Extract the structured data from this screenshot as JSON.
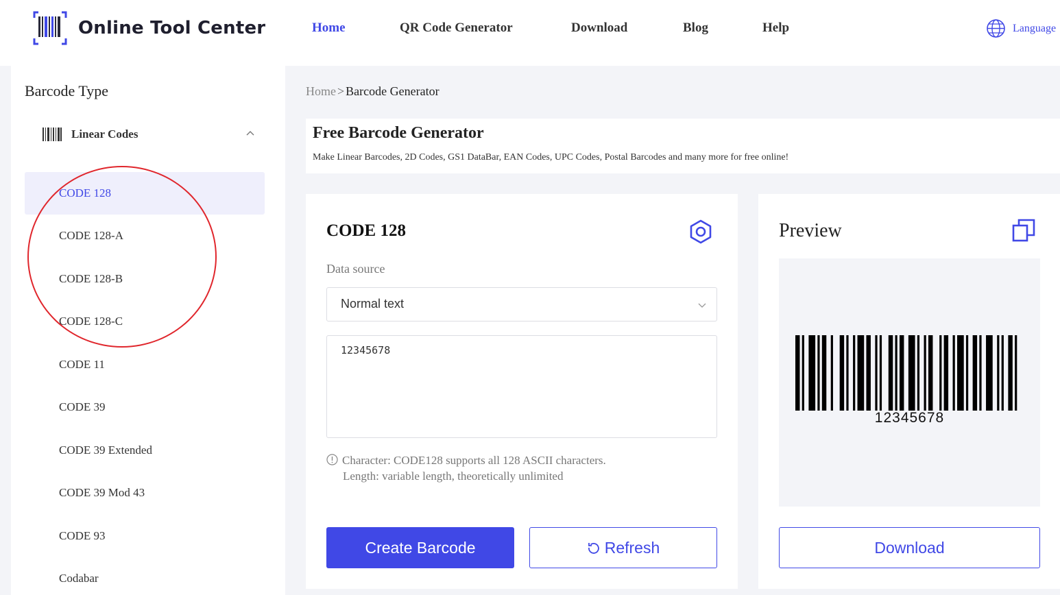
{
  "header": {
    "logo_text": "Online Tool Center",
    "nav": [
      {
        "label": "Home",
        "active": true
      },
      {
        "label": "QR Code Generator",
        "active": false
      },
      {
        "label": "Download",
        "active": false
      },
      {
        "label": "Blog",
        "active": false
      },
      {
        "label": "Help",
        "active": false
      }
    ],
    "language_label": "Language"
  },
  "sidebar": {
    "title": "Barcode Type",
    "group_label": "Linear Codes",
    "items": [
      {
        "label": "CODE 128",
        "active": true
      },
      {
        "label": "CODE 128-A"
      },
      {
        "label": "CODE 128-B"
      },
      {
        "label": "CODE 128-C"
      },
      {
        "label": "CODE 11"
      },
      {
        "label": "CODE 39"
      },
      {
        "label": "CODE 39 Extended"
      },
      {
        "label": "CODE 39 Mod 43"
      },
      {
        "label": "CODE 93"
      },
      {
        "label": "Codabar"
      }
    ]
  },
  "breadcrumb": {
    "home": "Home",
    "separator": ">",
    "current": "Barcode Generator"
  },
  "hero": {
    "title": "Free Barcode Generator",
    "subtitle": "Make Linear Barcodes, 2D Codes, GS1 DataBar, EAN Codes, UPC Codes, Postal Barcodes and many more for free online!"
  },
  "generator": {
    "title": "CODE 128",
    "data_source_label": "Data source",
    "data_source_value": "Normal text",
    "input_value": "12345678",
    "hint_line1": "Character: CODE128 supports all 128 ASCII characters.",
    "hint_line2": "Length: variable length, theoretically unlimited",
    "create_label": "Create Barcode",
    "refresh_label": "Refresh"
  },
  "preview": {
    "title": "Preview",
    "barcode_text": "12345678",
    "download_label": "Download"
  },
  "colors": {
    "accent": "#4048e6",
    "annotation": "#e0262c",
    "page_bg": "#f3f4f8"
  }
}
